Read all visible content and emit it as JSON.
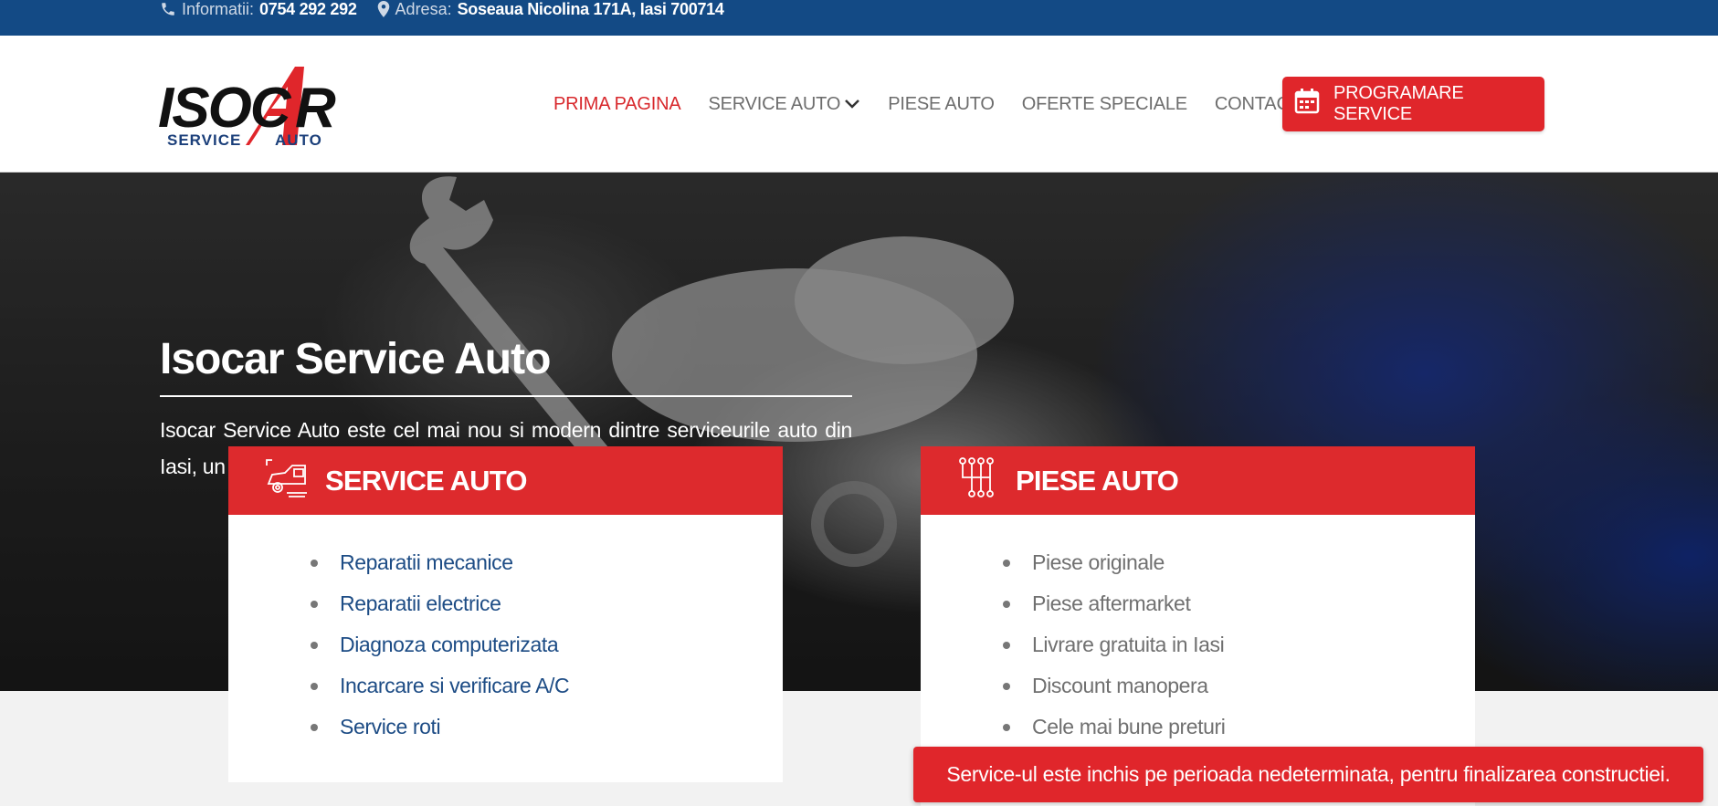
{
  "topbar": {
    "phone_label": "Informatii:",
    "phone_value": "0754 292 292",
    "address_label": "Adresa:",
    "address_value": "Soseaua Nicolina 171A, Iasi 700714"
  },
  "logo": {
    "brand": "ISOCAR",
    "sub_left": "SERVICE",
    "sub_right": "AUTO"
  },
  "nav": {
    "items": [
      {
        "label": "PRIMA PAGINA"
      },
      {
        "label": "SERVICE AUTO"
      },
      {
        "label": "PIESE AUTO"
      },
      {
        "label": "OFERTE SPECIALE"
      },
      {
        "label": "CONTACT"
      }
    ],
    "cta_label": "PROGRAMARE SERVICE"
  },
  "hero": {
    "title": "Isocar Service Auto",
    "text": "Isocar Service Auto este cel mai nou si modern dintre serviceurile auto din Iasi, un ulatori), diagnos"
  },
  "cards": {
    "service": {
      "title": "SERVICE AUTO",
      "items": [
        "Reparatii mecanice",
        "Reparatii electrice",
        "Diagnoza computerizata",
        "Incarcare si verificare A/C",
        "Service roti"
      ]
    },
    "piese": {
      "title": "PIESE AUTO",
      "items": [
        "Piese originale",
        "Piese aftermarket",
        "Livrare gratuita in Iasi",
        "Discount manopera",
        "Cele mai bune preturi"
      ]
    }
  },
  "notice": {
    "text": "Service-ul este inchis pe perioada nedeterminata, pentru finalizarea constructiei."
  },
  "colors": {
    "topbar": "#134a85",
    "accent_red": "#dd2a2d",
    "link_blue": "#1d4c85"
  },
  "icons": [
    "phone-icon",
    "map-pin-icon",
    "chevron-down-icon",
    "calendar-icon",
    "car-service-icon",
    "gearbox-icon"
  ]
}
